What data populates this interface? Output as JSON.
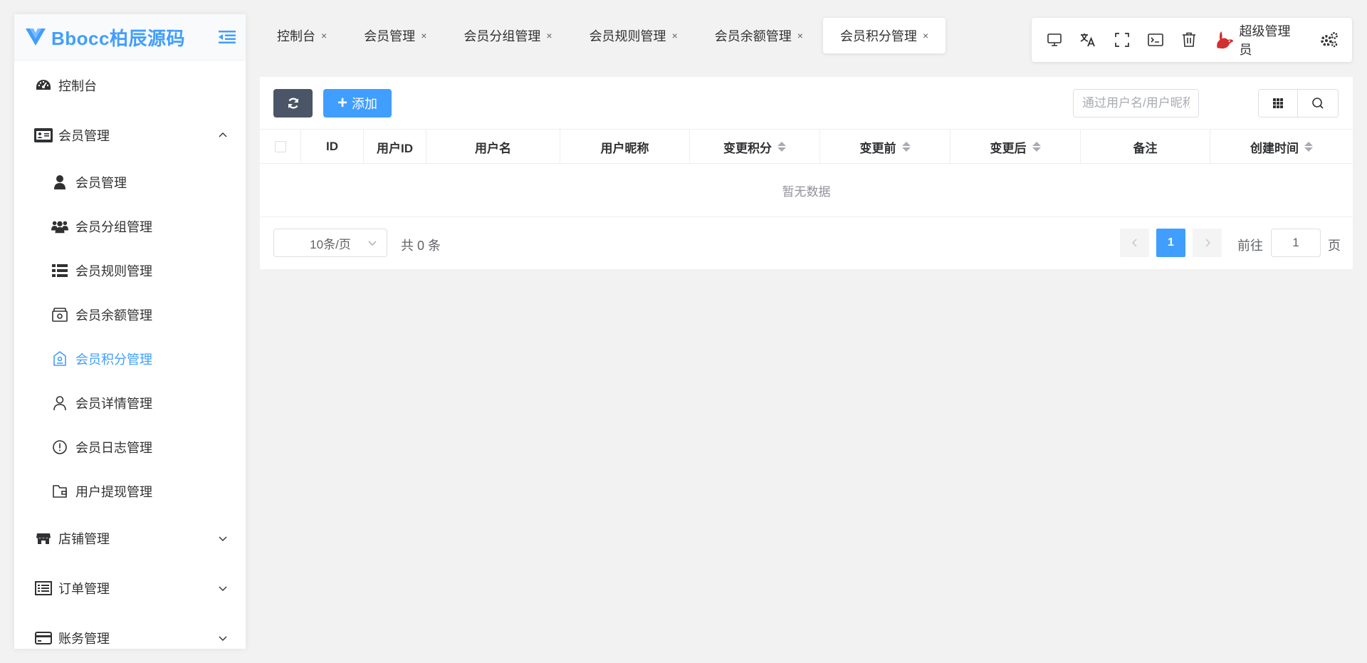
{
  "app": {
    "logo_text": "Bbocc柏辰源码",
    "brand_color": "#409eff"
  },
  "sidebar": {
    "items": [
      {
        "label": "控制台",
        "icon": "dashboard-icon"
      },
      {
        "label": "会员管理",
        "icon": "id-card-icon",
        "expanded": true
      },
      {
        "label": "店铺管理",
        "icon": "store-icon"
      },
      {
        "label": "订单管理",
        "icon": "list-alt-icon"
      },
      {
        "label": "账务管理",
        "icon": "credit-card-icon"
      }
    ],
    "sub_items": [
      {
        "label": "会员管理",
        "icon": "user-icon"
      },
      {
        "label": "会员分组管理",
        "icon": "users-icon"
      },
      {
        "label": "会员规则管理",
        "icon": "list-icon"
      },
      {
        "label": "会员余额管理",
        "icon": "wallet-icon"
      },
      {
        "label": "会员积分管理",
        "icon": "tag-icon",
        "active": true
      },
      {
        "label": "会员详情管理",
        "icon": "person-outline-icon"
      },
      {
        "label": "会员日志管理",
        "icon": "alert-circle-icon"
      },
      {
        "label": "用户提现管理",
        "icon": "purse-icon"
      }
    ]
  },
  "tabs": [
    {
      "label": "控制台"
    },
    {
      "label": "会员管理"
    },
    {
      "label": "会员分组管理"
    },
    {
      "label": "会员规则管理"
    },
    {
      "label": "会员余额管理"
    },
    {
      "label": "会员积分管理",
      "active": true
    }
  ],
  "tab_close_glyph": "×",
  "topbar": {
    "user_name": "超级管理员"
  },
  "toolbar": {
    "add_label": "添加",
    "search_placeholder": "通过用户名/用户昵称模糊搜索"
  },
  "table": {
    "columns": [
      "ID",
      "用户ID",
      "用户名",
      "用户昵称",
      "变更积分",
      "变更前",
      "变更后",
      "备注",
      "创建时间"
    ],
    "empty_text": "暂无数据"
  },
  "pagination": {
    "page_size": "10条/页",
    "total": "共 0 条",
    "current_page": "1",
    "goto_label": "前往",
    "goto_value": "1",
    "page_unit": "页"
  }
}
